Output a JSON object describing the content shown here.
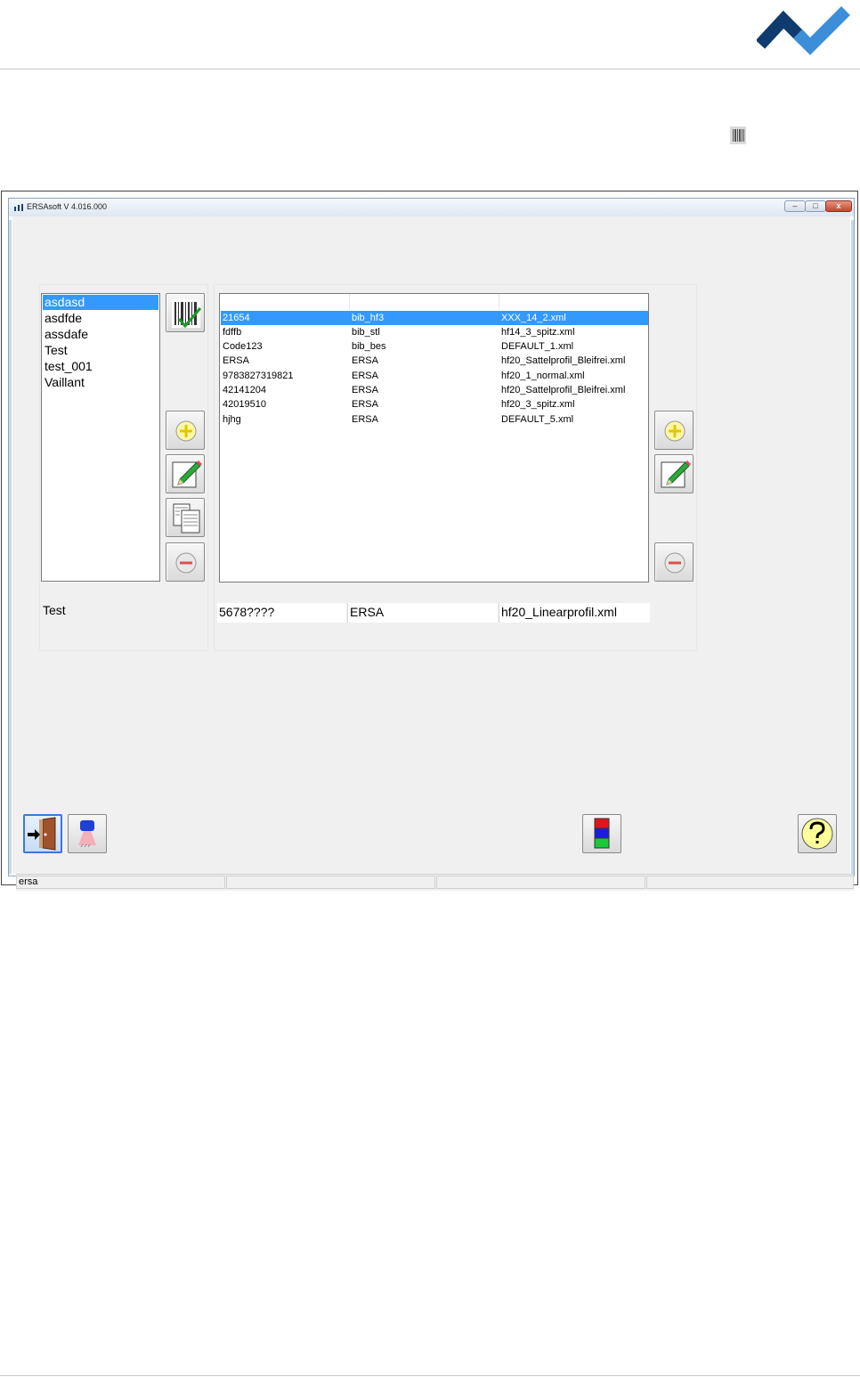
{
  "window": {
    "title": "ERSAsoft V 4.016.000",
    "controls": {
      "minimize": "–",
      "maximize": "□",
      "close": "x"
    }
  },
  "parts_list": {
    "items": [
      "asdasd",
      "asdfde",
      "assdafe",
      "Test",
      "test_001",
      "Vaillant"
    ],
    "selected_index": 0,
    "edit_value": "Test"
  },
  "profile_grid": {
    "columns": [
      "",
      "",
      ""
    ],
    "rows": [
      {
        "code": "21654",
        "library": "bib_hf3",
        "file": "XXX_14_2.xml",
        "selected": true
      },
      {
        "code": "fdffb",
        "library": "bib_stl",
        "file": "hf14_3_spitz.xml"
      },
      {
        "code": "Code123",
        "library": "bib_bes",
        "file": "DEFAULT_1.xml"
      },
      {
        "code": "ERSA",
        "library": "ERSA",
        "file": "hf20_Sattelprofil_Bleifrei.xml"
      },
      {
        "code": "9783827319821",
        "library": "ERSA",
        "file": "hf20_1_normal.xml"
      },
      {
        "code": "42141204",
        "library": "ERSA",
        "file": "hf20_Sattelprofil_Bleifrei.xml"
      },
      {
        "code": "42019510",
        "library": "ERSA",
        "file": "hf20_3_spitz.xml"
      },
      {
        "code": "hjhg",
        "library": "ERSA",
        "file": "DEFAULT_5.xml"
      }
    ],
    "edit_row": {
      "code": "5678????",
      "library": "ERSA",
      "file": "hf20_Linearprofil.xml"
    }
  },
  "icons": {
    "barcode_scan": "barcode-check-icon",
    "add": "plus-circle-icon",
    "edit": "pencil-icon",
    "copy": "copy-documents-icon",
    "remove": "minus-circle-icon",
    "exit": "door-exit-icon",
    "camera": "camera-icon",
    "colors": "color-stack-icon",
    "help": "help-icon"
  },
  "status_bar": {
    "panels": [
      "ersa",
      "",
      "",
      ""
    ]
  },
  "colors": {
    "selection": "#3399ff",
    "logo": "#0f3b6e",
    "logo_accent": "#3d8ed8"
  }
}
